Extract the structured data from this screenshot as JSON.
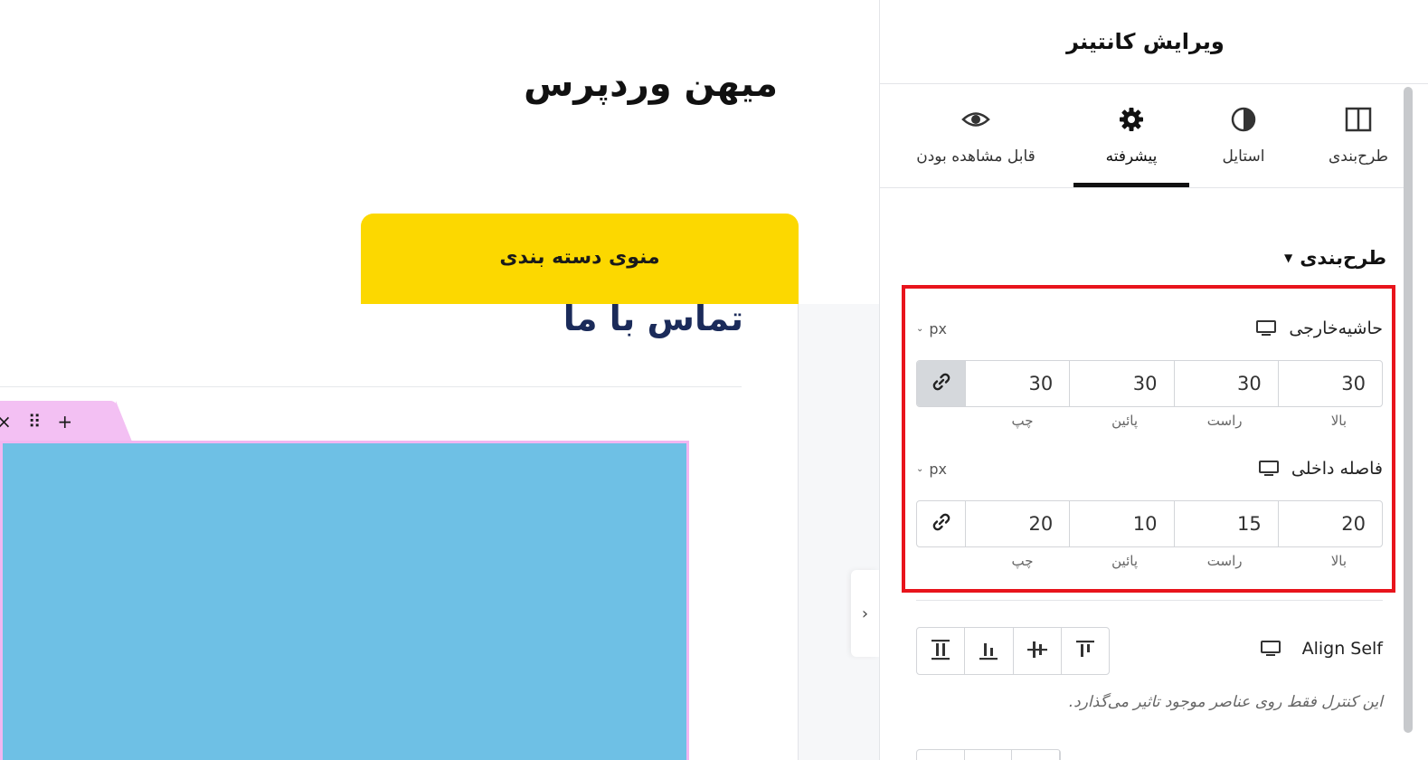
{
  "canvas": {
    "site_title": "میهن وردپرس",
    "category_menu": "منوی دسته بندی",
    "contact_title": "تماس با ما",
    "element_handle": {
      "add": "+",
      "drag": "⠿",
      "close": "×"
    }
  },
  "panel": {
    "title": "ویرایش کانتینر",
    "tabs": [
      {
        "label": "طرح‌بندی",
        "icon": "layout-icon"
      },
      {
        "label": "استایل",
        "icon": "half-circle-icon"
      },
      {
        "label": "پیشرفته",
        "icon": "gear-icon",
        "active": true
      },
      {
        "label": "قابل مشاهده بودن",
        "icon": "eye-icon"
      }
    ],
    "section": {
      "title": "طرح‌بندی"
    },
    "margin": {
      "label": "حاشیه‌خارجی",
      "unit": "px",
      "top": "30",
      "right": "30",
      "bottom": "30",
      "left": "30",
      "labels": {
        "top": "بالا",
        "right": "راست",
        "bottom": "پائین",
        "left": "چپ"
      },
      "linked": true
    },
    "padding": {
      "label": "فاصله داخلی",
      "unit": "px",
      "top": "20",
      "right": "15",
      "bottom": "10",
      "left": "20",
      "labels": {
        "top": "بالا",
        "right": "راست",
        "bottom": "پائین",
        "left": "چپ"
      },
      "linked": false
    },
    "align_self": {
      "label": "Align Self",
      "note": "این کنترل فقط روی عناصر موجود تاثیر می‌گذارد."
    }
  },
  "colors": {
    "menu_bg": "#fcd800",
    "element_bg": "#6ec0e5",
    "handle_bg": "#f3c0f3",
    "highlight": "#e8141c",
    "contact_title": "#1b2b5a"
  }
}
